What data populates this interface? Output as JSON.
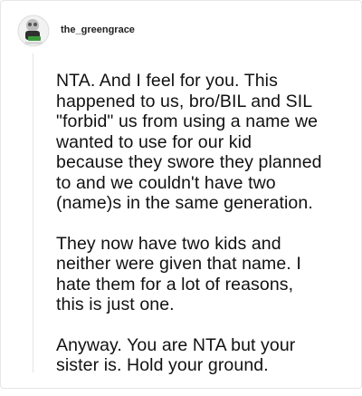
{
  "post": {
    "username": "the_greengrace",
    "avatar_icon": "tumblr-avatar-icon",
    "paragraphs": [
      "NTA. And I feel for you. This\nhappened to us, bro/BIL and SIL\n\"forbid\" us from using a name we\nwanted to use for our kid\nbecause they swore they planned\nto and we couldn't have two\n(name)s in the same generation.",
      "They now have two kids and\nneither were given that name. I\nhate them for a lot of reasons,\nthis is just one.",
      "Anyway. You are NTA but your\nsister is. Hold your ground."
    ]
  },
  "colors": {
    "text": "#111111",
    "border": "#e6e6e6",
    "avatar_accent": "#3a9a3a"
  }
}
